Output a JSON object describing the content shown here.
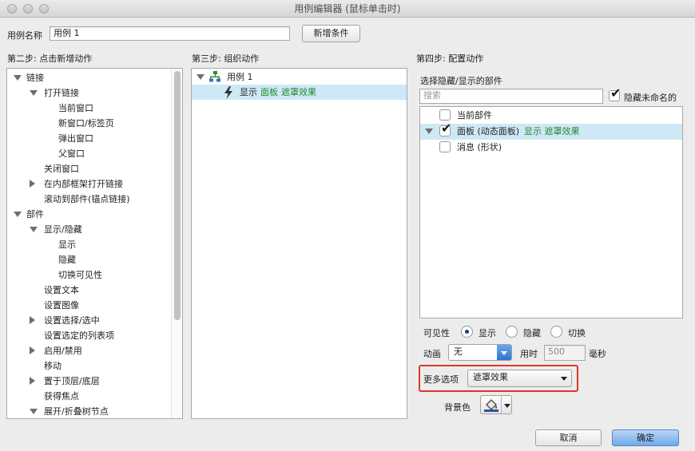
{
  "window": {
    "title": "用例编辑器 (鼠标单击时)"
  },
  "case_name": {
    "label": "用例名称",
    "value": "用例 1",
    "add_condition": "新增条件"
  },
  "step2": {
    "title": "第二步: 点击新增动作",
    "items": [
      {
        "label": "链接",
        "level": 0,
        "toggle": "down"
      },
      {
        "label": "打开链接",
        "level": 1,
        "toggle": "down"
      },
      {
        "label": "当前窗口",
        "level": 2,
        "toggle": ""
      },
      {
        "label": "新窗口/标签页",
        "level": 2,
        "toggle": ""
      },
      {
        "label": "弹出窗口",
        "level": 2,
        "toggle": ""
      },
      {
        "label": "父窗口",
        "level": 2,
        "toggle": ""
      },
      {
        "label": "关闭窗口",
        "level": 1,
        "toggle": ""
      },
      {
        "label": "在内部框架打开链接",
        "level": 1,
        "toggle": "right"
      },
      {
        "label": "滚动到部件(锚点链接)",
        "level": 1,
        "toggle": ""
      },
      {
        "label": "部件",
        "level": 0,
        "toggle": "down"
      },
      {
        "label": "显示/隐藏",
        "level": 1,
        "toggle": "down"
      },
      {
        "label": "显示",
        "level": 2,
        "toggle": ""
      },
      {
        "label": "隐藏",
        "level": 2,
        "toggle": ""
      },
      {
        "label": "切换可见性",
        "level": 2,
        "toggle": ""
      },
      {
        "label": "设置文本",
        "level": 1,
        "toggle": ""
      },
      {
        "label": "设置图像",
        "level": 1,
        "toggle": ""
      },
      {
        "label": "设置选择/选中",
        "level": 1,
        "toggle": "right"
      },
      {
        "label": "设置选定的列表项",
        "level": 1,
        "toggle": ""
      },
      {
        "label": "启用/禁用",
        "level": 1,
        "toggle": "right"
      },
      {
        "label": "移动",
        "level": 1,
        "toggle": ""
      },
      {
        "label": "置于顶层/底层",
        "level": 1,
        "toggle": "right"
      },
      {
        "label": "获得焦点",
        "level": 1,
        "toggle": ""
      },
      {
        "label": "展开/折叠树节点",
        "level": 1,
        "toggle": "down"
      }
    ]
  },
  "step3": {
    "title": "第三步: 组织动作",
    "case_label": "用例 1",
    "action": {
      "verb": "显示",
      "target": "面板",
      "effect": "遮罩效果"
    }
  },
  "step4": {
    "title": "第四步: 配置动作",
    "subtitle": "选择隐藏/显示的部件",
    "search_placeholder": "搜索",
    "hide_unnamed_label": "隐藏未命名的",
    "widgets": [
      {
        "label": "当前部件",
        "checked": false,
        "extra": "",
        "selected": false
      },
      {
        "label": "面板 (动态面板)",
        "checked": true,
        "extra": "显示 遮罩效果",
        "selected": true
      },
      {
        "label": "消息 (形状)",
        "checked": false,
        "extra": "",
        "selected": false
      }
    ],
    "visibility": {
      "label": "可见性",
      "options": [
        "显示",
        "隐藏",
        "切换"
      ],
      "selected": "显示"
    },
    "animation": {
      "label": "动画",
      "value": "无",
      "duration_label": "用时",
      "duration_value": "500",
      "unit": "毫秒"
    },
    "more_options": {
      "label": "更多选项",
      "value": "遮罩效果"
    },
    "background_label": "背景色"
  },
  "footer": {
    "cancel": "取消",
    "ok": "确定"
  },
  "colors": {
    "accent": "#3b7fe0",
    "highlight": "#cfe8f6",
    "green_text": "#1f8a2e",
    "red_box": "#d9362b"
  }
}
